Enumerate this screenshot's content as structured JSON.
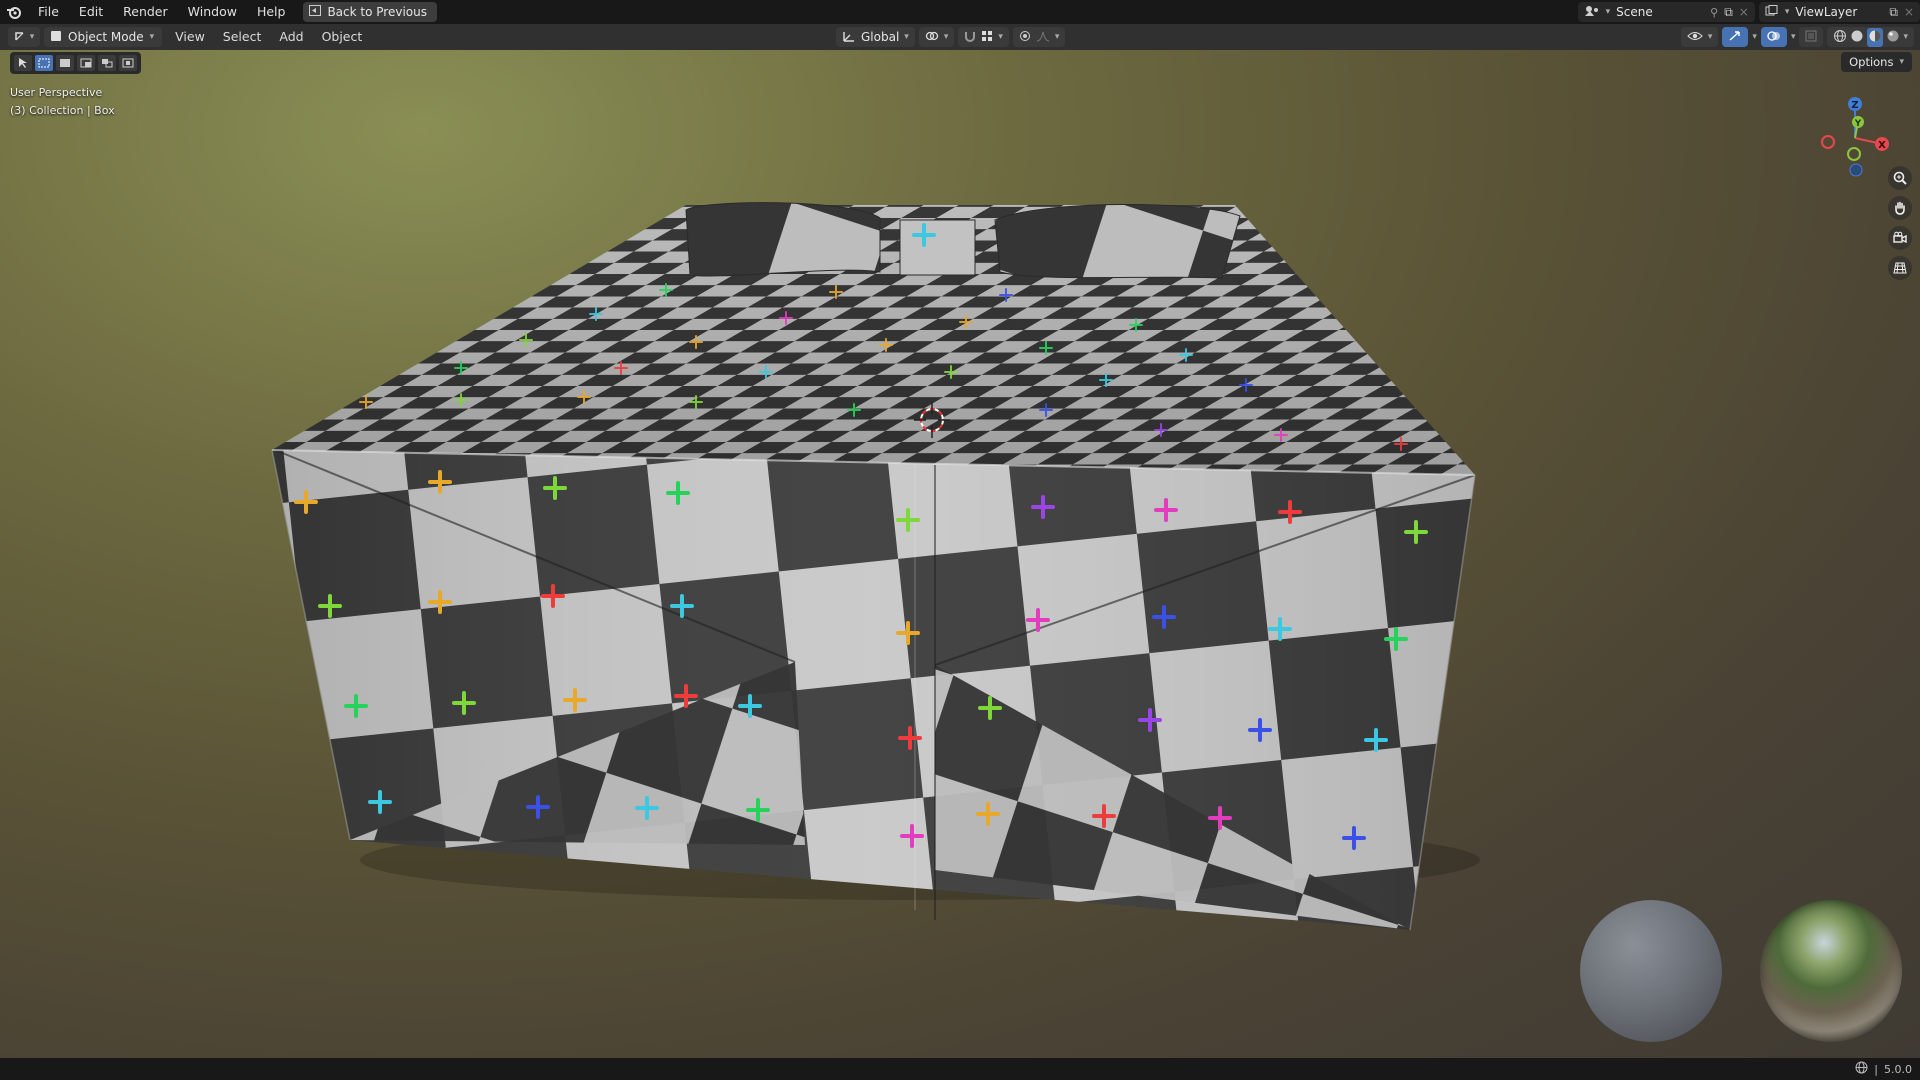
{
  "menubar": {
    "items": [
      "File",
      "Edit",
      "Render",
      "Window",
      "Help"
    ],
    "back_button": "Back to Previous"
  },
  "topbar_right": {
    "scene": "Scene",
    "view_layer": "ViewLayer"
  },
  "header": {
    "mode": "Object Mode",
    "menus": [
      "View",
      "Select",
      "Add",
      "Object"
    ],
    "transform_orientation": "Global"
  },
  "viewport": {
    "perspective_label": "User Perspective",
    "collection_label": "(3) Collection | Box",
    "options_label": "Options",
    "gizmo_axes": {
      "x": "X",
      "y": "Y",
      "z": "Z"
    },
    "colors": {
      "x_axis": "#e5484d",
      "y_axis": "#8cc63f",
      "z_axis": "#3f7fd6",
      "checker_light": "#c9c9c9",
      "checker_dark": "#3a3a3a",
      "active_tool": "#4772b3"
    },
    "object_name": "Box"
  },
  "statusbar": {
    "version": "5.0.0"
  }
}
